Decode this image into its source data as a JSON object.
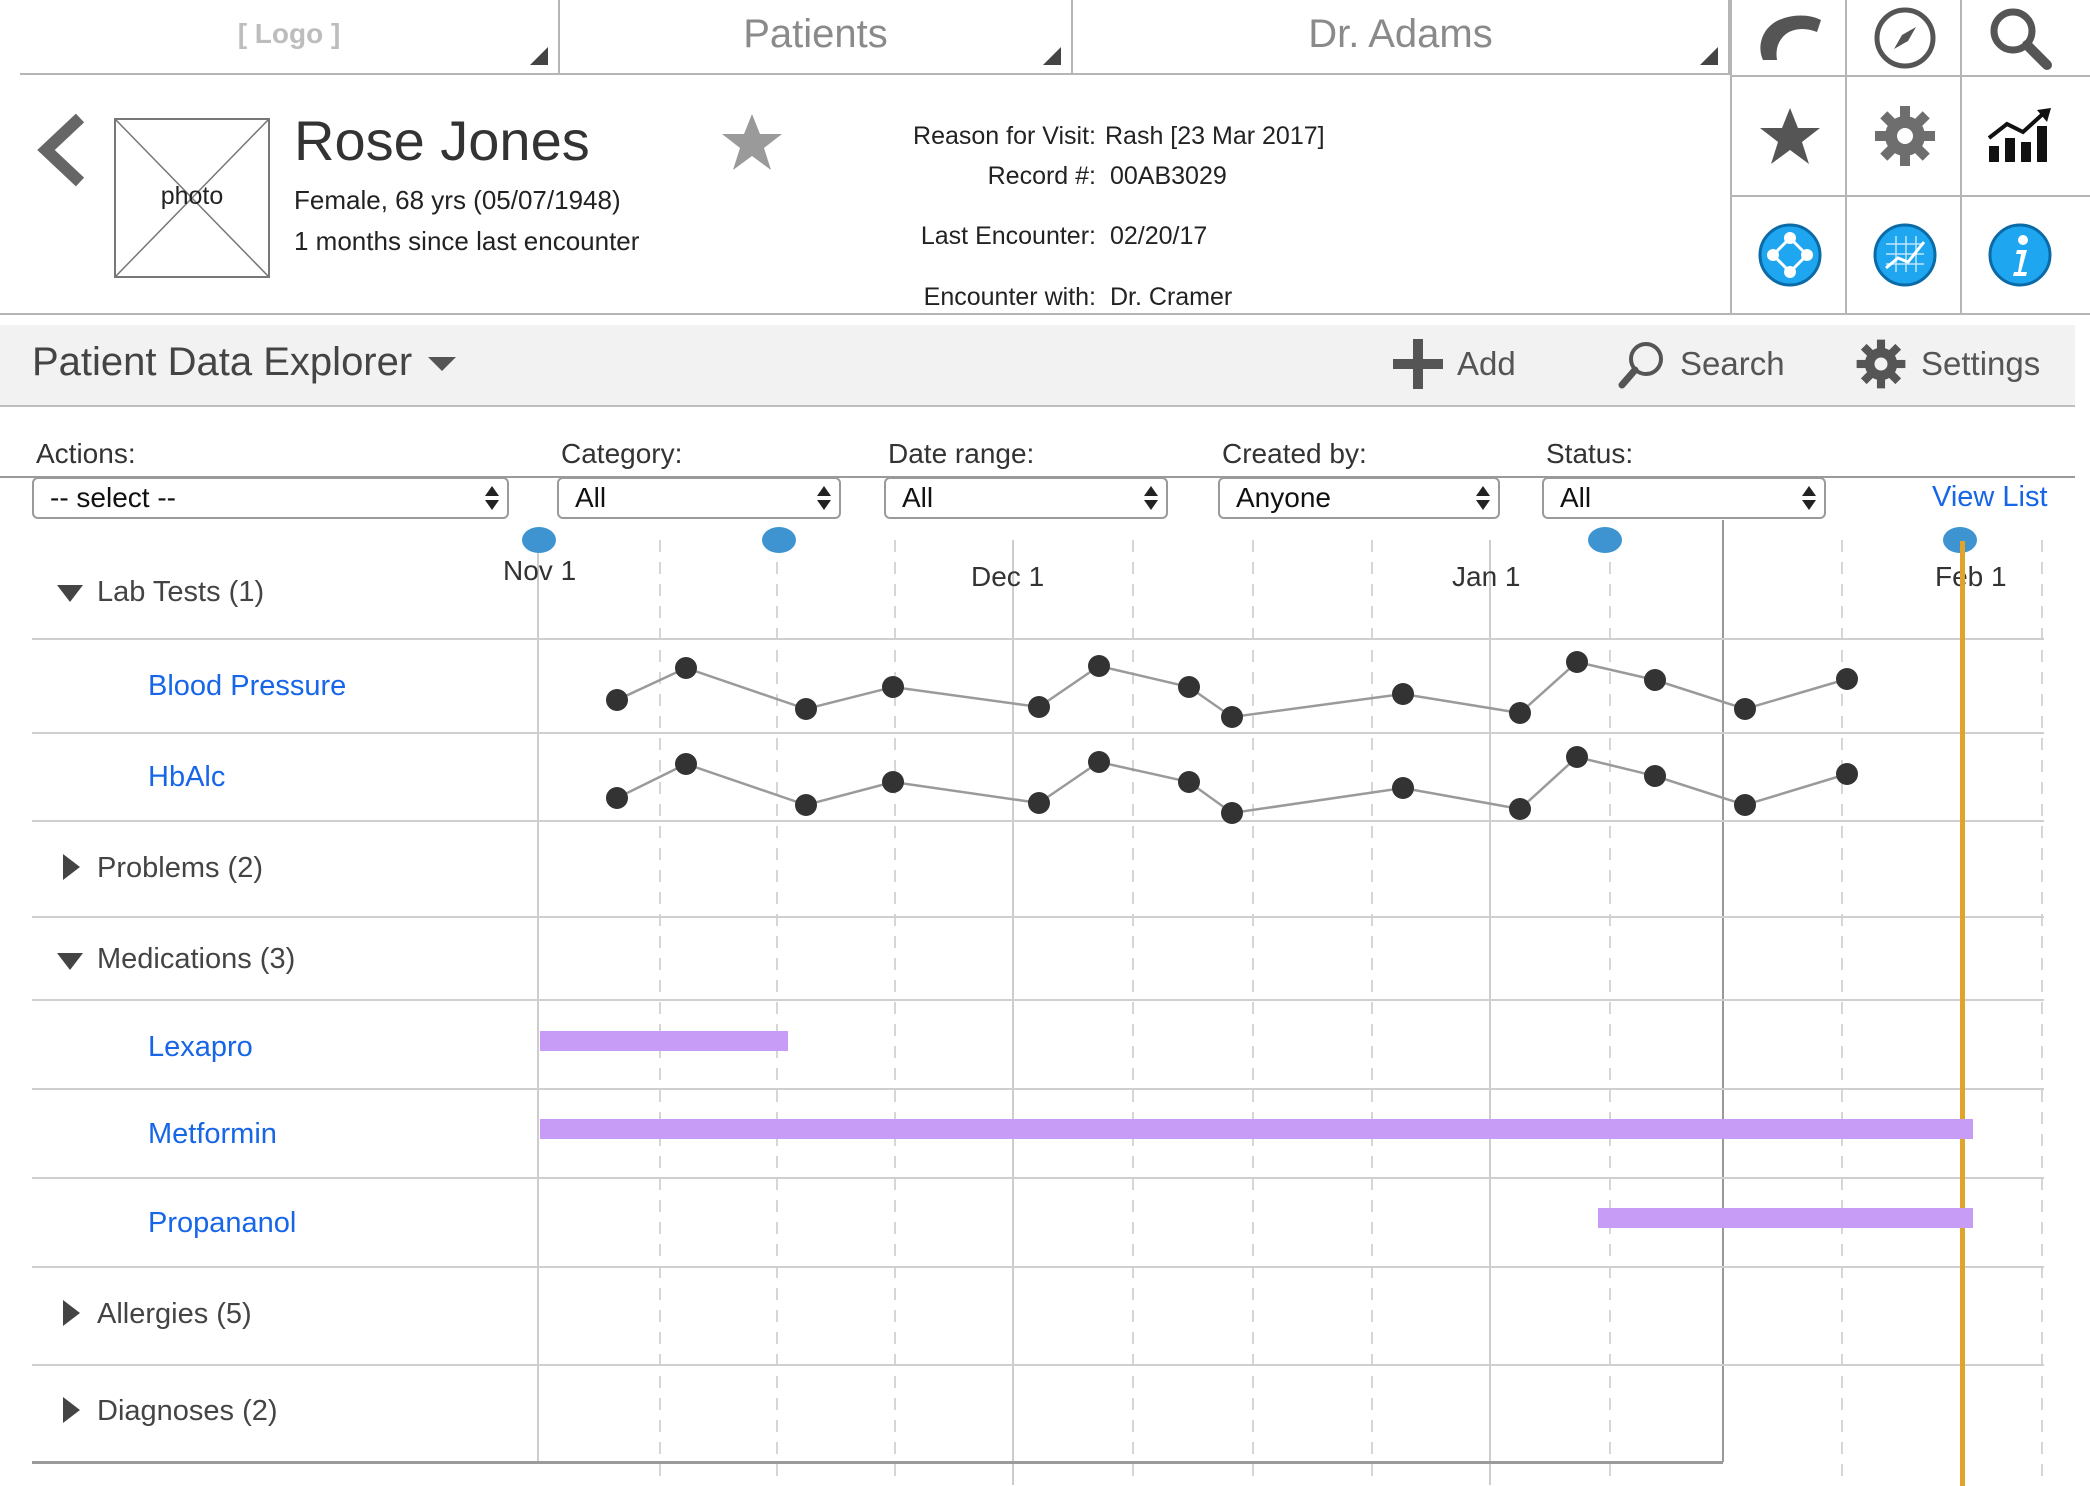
{
  "nav": {
    "logo": "[ Logo ]",
    "patients": "Patients",
    "doctor": "Dr. Adams"
  },
  "patient": {
    "photo_label": "photo",
    "name": "Rose Jones",
    "demographics": "Female, 68 yrs (05/07/1948)",
    "since_last": "1 months since last encounter",
    "visit_label": "Reason for Visit:",
    "visit_value": "Rash [23 Mar 2017]",
    "record_label": "Record #:",
    "record_value": "00AB3029",
    "last_label": "Last Encounter:",
    "last_value": "02/20/17",
    "with_label": "Encounter with:",
    "with_value": "Dr. Cramer"
  },
  "icons": [
    "phone-icon",
    "compass-icon",
    "search-icon",
    "star-icon",
    "gear-icon",
    "chart-icon",
    "network-icon",
    "graph-icon",
    "info-icon"
  ],
  "toolbar": {
    "title": "Patient Data Explorer",
    "add": "Add",
    "search": "Search",
    "settings": "Settings"
  },
  "filters": {
    "actions_label": "Actions:",
    "actions_value": "-- select --",
    "category_label": "Category:",
    "category_value": "All",
    "date_label": "Date range:",
    "date_value": "All",
    "created_label": "Created by:",
    "created_value": "Anyone",
    "status_label": "Status:",
    "status_value": "All",
    "view_list": "View List"
  },
  "timeline": {
    "months": [
      "Nov 1",
      "Dec 1",
      "Jan 1",
      "Feb 1"
    ],
    "rows": {
      "lab_tests": "Lab Tests (1)",
      "blood_pressure": "Blood Pressure",
      "hba1c": "HbAlc",
      "problems": "Problems (2)",
      "medications": "Medications (3)",
      "lexapro": "Lexapro",
      "metformin": "Metformin",
      "propananol": "Propananol",
      "allergies": "Allergies (5)",
      "diagnoses": "Diagnoses (2)"
    },
    "medication_spans": {
      "lexapro": [
        "Nov 1",
        "Nov 16"
      ],
      "metformin": [
        "Nov 1",
        "Feb 1"
      ],
      "propananol": [
        "Jan 8",
        "Feb 1"
      ]
    },
    "accent": "#e2a32a",
    "bar_color": "#c79cf6",
    "marker_color": "#3d94d0"
  }
}
